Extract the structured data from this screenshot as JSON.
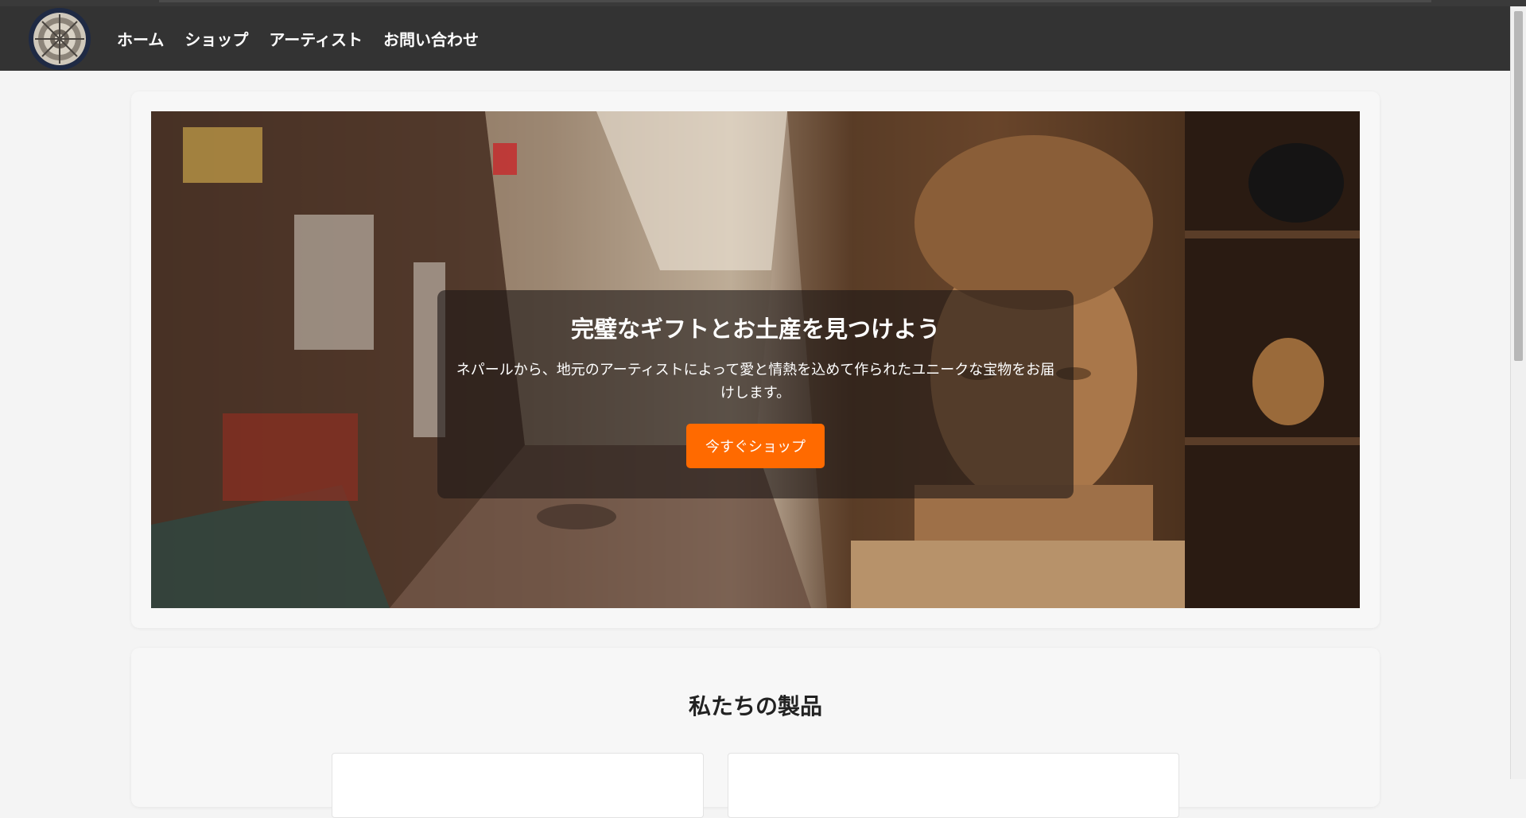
{
  "nav": {
    "logo_icon": "mandala-logo-icon",
    "links": [
      "ホーム",
      "ショップ",
      "アーティスト",
      "お問い合わせ"
    ]
  },
  "hero": {
    "title": "完璧なギフトとお土産を見つけよう",
    "subtitle": "ネパールから、地元のアーティストによって愛と情熱を込めて作られたユニークな宝物をお届けします。",
    "button_label": "今すぐショップ"
  },
  "products": {
    "title": "私たちの製品"
  },
  "colors": {
    "navbar": "#333333",
    "accent": "#ff6a00",
    "background": "#f4f4f4"
  }
}
